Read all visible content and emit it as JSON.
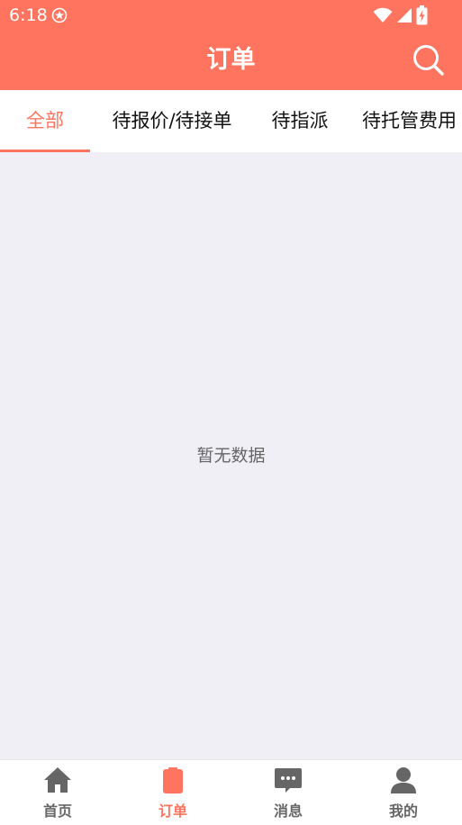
{
  "status_bar": {
    "time": "6:18",
    "icons": [
      "app-badge-icon",
      "wifi-icon",
      "cellular-signal-icon",
      "battery-charging-icon"
    ]
  },
  "app_bar": {
    "title": "订单",
    "search_icon": "search-icon"
  },
  "tabs": [
    {
      "label": "全部",
      "active": true
    },
    {
      "label": "待报价/待接单",
      "active": false
    },
    {
      "label": "待指派",
      "active": false
    },
    {
      "label": "待托管费用",
      "active": false
    }
  ],
  "content": {
    "empty_text": "暂无数据"
  },
  "bottom_nav": [
    {
      "label": "首页",
      "icon": "home-icon",
      "active": false
    },
    {
      "label": "订单",
      "icon": "clipboard-icon",
      "active": true
    },
    {
      "label": "消息",
      "icon": "message-icon",
      "active": false
    },
    {
      "label": "我的",
      "icon": "user-icon",
      "active": false
    }
  ],
  "colors": {
    "accent": "#ff745f",
    "background": "#f0eff5",
    "inactive_nav": "#666666"
  }
}
